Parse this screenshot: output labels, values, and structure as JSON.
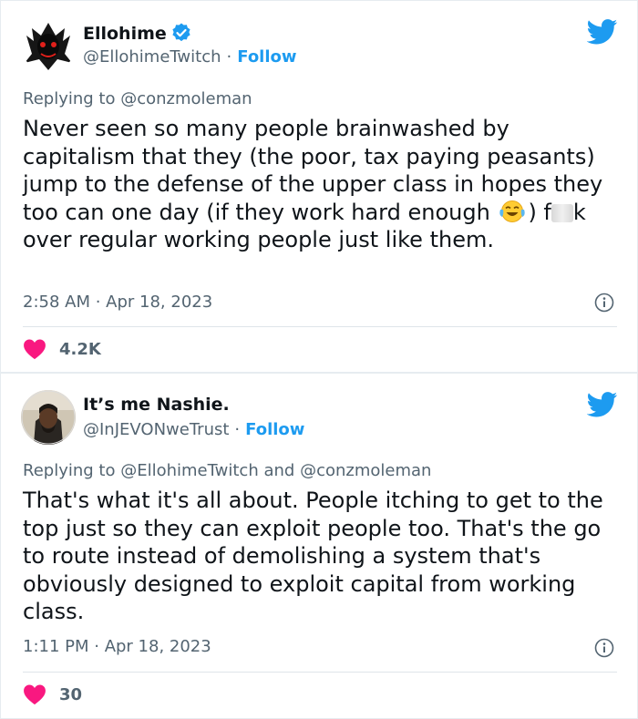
{
  "colors": {
    "accent": "#1d9bf0",
    "like": "#f91880",
    "secondary_text": "#536471"
  },
  "tweets": [
    {
      "author_name": "Ellohime",
      "verified": true,
      "handle": "@EllohimeTwitch",
      "separator": "·",
      "follow_label": "Follow",
      "reply_prefix": "Replying to",
      "reply_mention": "@conzmoleman",
      "text_part1": "Never seen so many people brainwashed by capitalism that they (the poor, tax paying peasants) jump to the defense of the upper class in hopes they too can one day (if they work hard enough",
      "emoji": "face-with-tears-of-joy",
      "text_part2a": ") f",
      "text_part2b": "k over regular working people just like them.",
      "timestamp": "2:58 AM · Apr 18, 2023",
      "like_count": "4.2K",
      "icons": [
        "twitter-bird-icon",
        "verified-badge-icon",
        "info-icon",
        "heart-icon"
      ]
    },
    {
      "author_name": "It’s me Nashie.",
      "verified": false,
      "handle": "@InJEVONweTrust",
      "separator": "·",
      "follow_label": "Follow",
      "reply_prefix": "Replying to",
      "reply_mention": "@EllohimeTwitch",
      "reply_and": "and",
      "reply_mention2": "@conzmoleman",
      "text": "That's what it's all about. People itching to get to the top just so they can exploit people too. That's the go to route instead of demolishing a system that's obviously designed to exploit capital from working class.",
      "timestamp": "1:11 PM · Apr 18, 2023",
      "like_count": "30",
      "icons": [
        "twitter-bird-icon",
        "info-icon",
        "heart-icon"
      ]
    }
  ]
}
